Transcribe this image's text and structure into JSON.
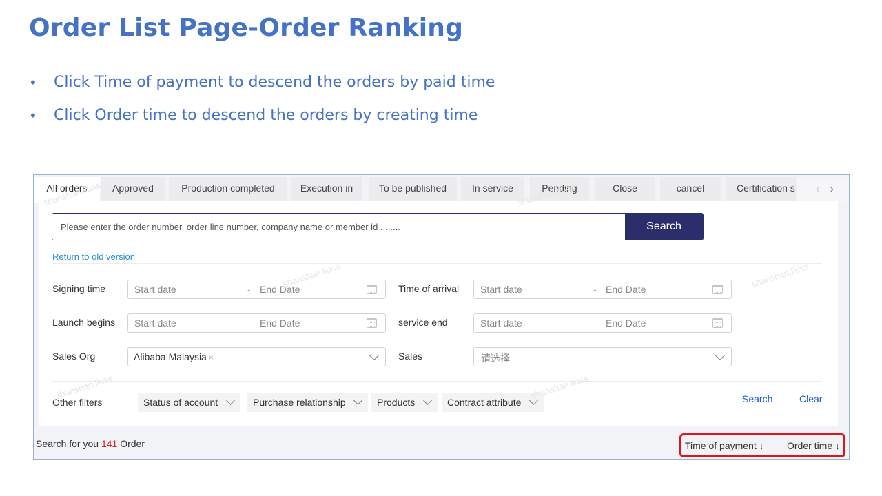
{
  "slide": {
    "title": "Order List Page-Order Ranking",
    "bullets": [
      "Click Time of payment to descend the orders by paid time",
      "Click Order time to descend the orders by creating time"
    ]
  },
  "tabs": [
    "All orders",
    "Approved",
    "Production completed",
    "Execution in",
    "To be published",
    "In service",
    "Pending",
    "Close",
    "cancel",
    "Certification s"
  ],
  "tab_nav": {
    "prev": "‹",
    "next": "›"
  },
  "search": {
    "placeholder": "Please enter the order number, order line number, company name or member id ........",
    "button": "Search"
  },
  "old_version_link": "Return to old version",
  "filters": {
    "signing_time": "Signing time",
    "time_of_arrival": "Time of arrival",
    "launch_begins": "Launch begins",
    "service_end": "service end",
    "sales_org": "Sales Org",
    "sales": "Sales",
    "start_date": "Start date",
    "end_date": "End Date",
    "dash": "-",
    "sales_org_value": "Alibaba Malaysia",
    "tag_remove": "×",
    "sales_placeholder": "请选择"
  },
  "other_filters": {
    "label": "Other filters",
    "chips": [
      "Status of account",
      "Purchase relationship",
      "Products",
      "Contract attribute"
    ],
    "search": "Search",
    "clear": "Clear"
  },
  "results": {
    "prefix": "Search for you",
    "count": "141",
    "suffix": "Order"
  },
  "sort": {
    "time_of_payment": "Time of payment ↓",
    "order_time": "Order time ↓"
  },
  "colors": {
    "title_blue": "#4472c4",
    "search_button": "#2b2e6a",
    "link_blue": "#1c8fd6",
    "highlight_red": "#e0151b",
    "count_red": "#e02020"
  }
}
